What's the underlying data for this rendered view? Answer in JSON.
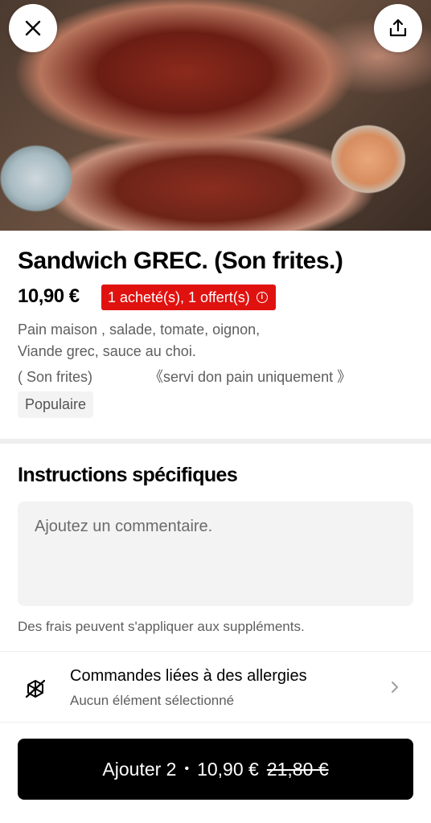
{
  "hero": {
    "image": "grilled-meat-sandwich-photo",
    "close_icon": "close-icon",
    "share_icon": "share-icon"
  },
  "product": {
    "title": "Sandwich GREC. (Son frites.)",
    "price": "10,90 €",
    "promo": "1 acheté(s), 1 offert(s)",
    "promo_color": "#e0120f",
    "description": [
      "Pain maison , salade, tomate, oignon,",
      "Viande grec, sauce au choi.",
      "( Son frites)              《servi don pain uniquement 》"
    ],
    "badge": "Populaire"
  },
  "instructions": {
    "title": "Instructions spécifiques",
    "placeholder": "Ajoutez un commentaire.",
    "fees_note": "Des frais peuvent s'appliquer aux suppléments."
  },
  "allergies": {
    "title": "Commandes liées à des allergies",
    "subtitle": "Aucun élément sélectionné",
    "icon": "allergy-icon"
  },
  "cart_button": {
    "label": "Ajouter 2",
    "separator": "•",
    "price": "10,90 €",
    "original_price": "21,80 €"
  }
}
